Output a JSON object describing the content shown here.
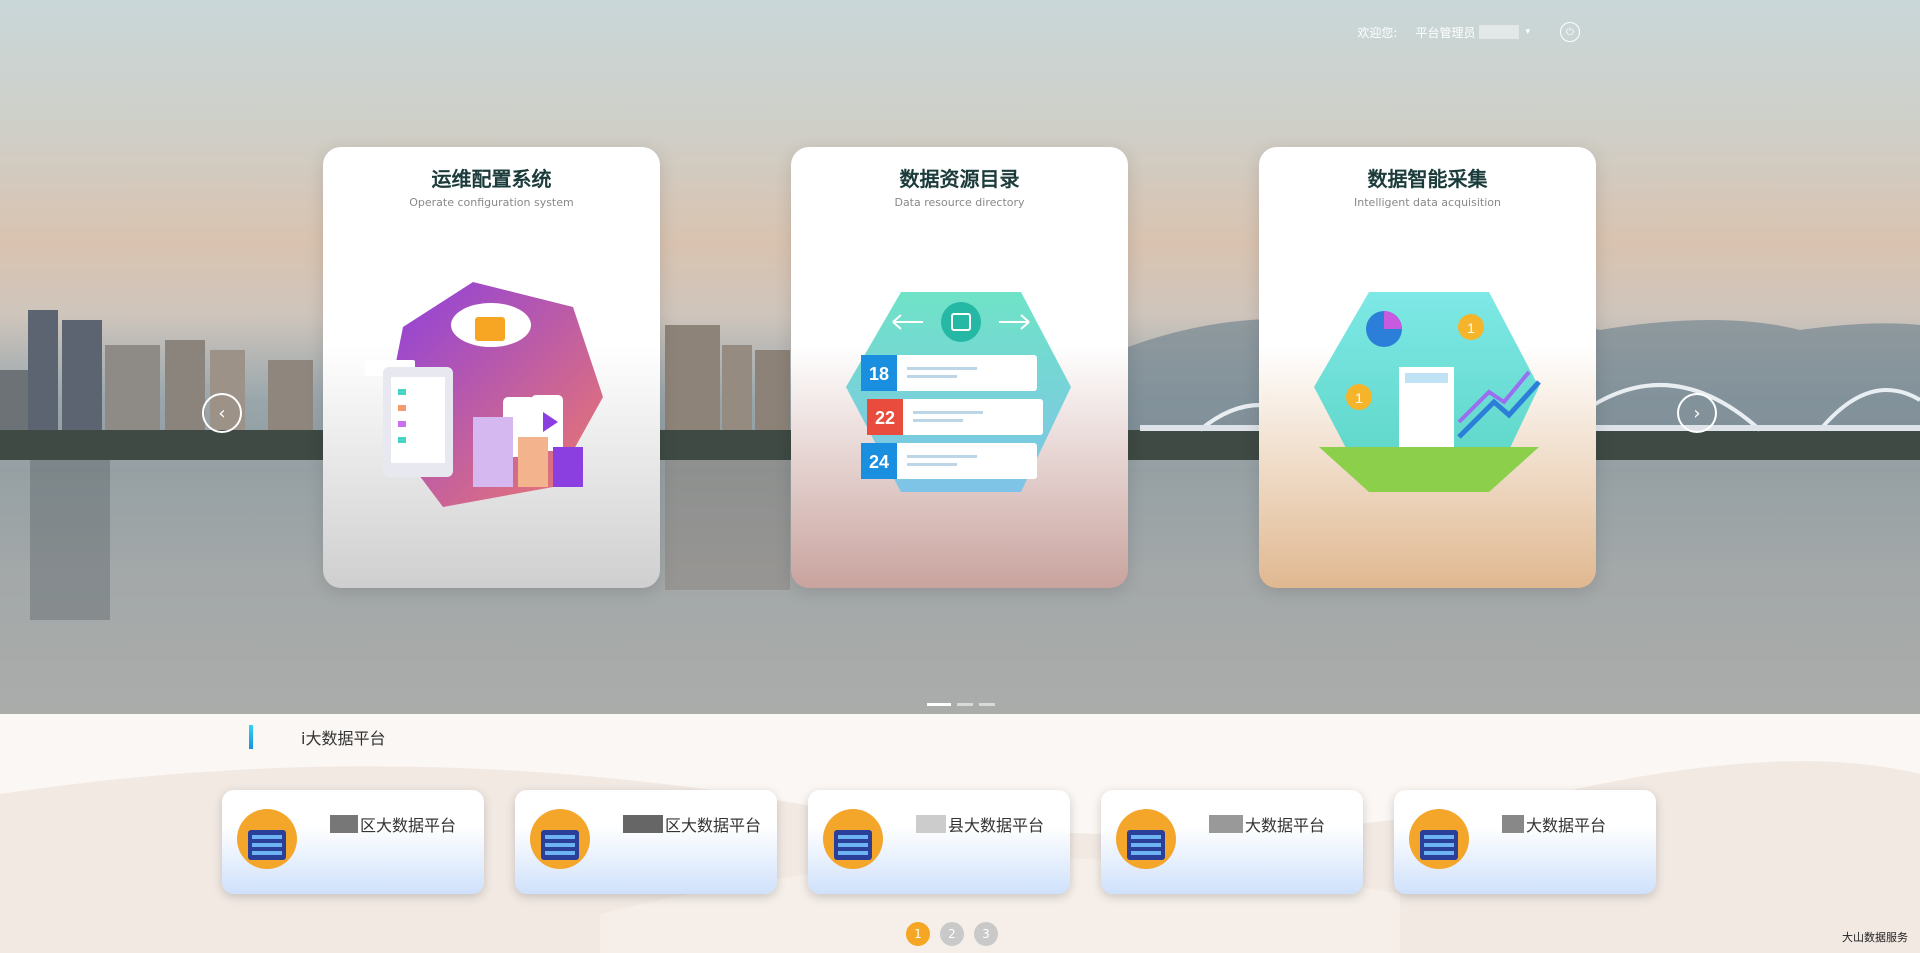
{
  "header": {
    "welcome_label": "欢迎您:",
    "user_name": "平台管理员",
    "user_caret": "▾",
    "logout_icon": "power-icon"
  },
  "carousel": {
    "cards": [
      {
        "title": "运维配置系统",
        "subtitle": "Operate configuration system",
        "icon": "ops-config-illustration"
      },
      {
        "title": "数据资源目录",
        "subtitle": "Data resource directory",
        "icon": "data-directory-illustration",
        "rows": [
          "18",
          "22",
          "24"
        ]
      },
      {
        "title": "数据智能采集",
        "subtitle": "Intelligent data acquisition",
        "icon": "data-acquisition-illustration",
        "coins": [
          "1",
          "1"
        ]
      }
    ],
    "prev_glyph": "‹",
    "next_glyph": "›",
    "active_slide": 1,
    "slide_count": 3
  },
  "section": {
    "title": "i大数据平台"
  },
  "platforms": [
    {
      "name": "区大数据平台"
    },
    {
      "name": "区大数据平台"
    },
    {
      "name": "县大数据平台"
    },
    {
      "name": "大数据平台"
    },
    {
      "name": "大数据平台"
    }
  ],
  "pager": {
    "pages": [
      "1",
      "2",
      "3"
    ],
    "current": "1"
  },
  "footer": {
    "text": "大山数据服务"
  },
  "colors": {
    "accent_orange": "#f5a623",
    "title_bar": "#1a8fe0"
  }
}
